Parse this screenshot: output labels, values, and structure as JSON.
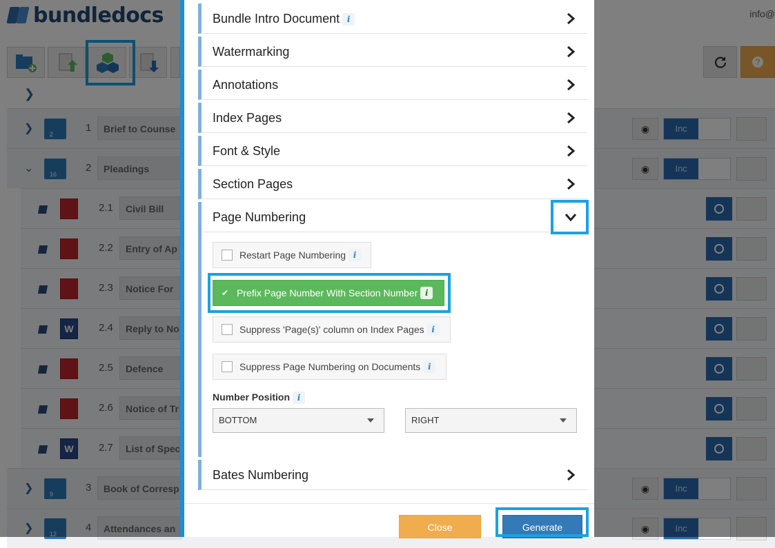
{
  "app": {
    "logo_text": "bundledocs",
    "user_label": "info@"
  },
  "colors": {
    "accent": "#1ba1e2",
    "primary": "#337ab7",
    "success": "#5cb85c",
    "warning": "#f0ad4e"
  },
  "toolbar": {
    "icons": [
      "folder-add-icon",
      "upload-icon",
      "generate-cubes-icon",
      "download-icon"
    ],
    "refresh_icon": "refresh-icon",
    "help_icon": "help-icon"
  },
  "tree": {
    "rows": [
      {
        "num": "1",
        "label": "Brief to Counse",
        "badge": "2",
        "type": "section"
      },
      {
        "num": "2",
        "label": "Pleadings",
        "badge": "16",
        "type": "section"
      },
      {
        "num": "2.1",
        "label": "Civil Bill",
        "type": "pdf"
      },
      {
        "num": "2.2",
        "label": "Entry of Ap",
        "type": "pdf"
      },
      {
        "num": "2.3",
        "label": "Notice For",
        "type": "pdf"
      },
      {
        "num": "2.4",
        "label": "Reply to No",
        "type": "word"
      },
      {
        "num": "2.5",
        "label": "Defence",
        "type": "pdf"
      },
      {
        "num": "2.6",
        "label": "Notice of Tr",
        "type": "pdf"
      },
      {
        "num": "2.7",
        "label": "List of Spec",
        "type": "word"
      },
      {
        "num": "3",
        "label": "Book of Corresp",
        "badge": "9",
        "type": "section"
      },
      {
        "num": "4",
        "label": "Attendances an",
        "badge": "12",
        "type": "section"
      }
    ],
    "inc_label": "Inc"
  },
  "modal": {
    "sections": [
      {
        "title": "Bundle Intro Document",
        "info": "i"
      },
      {
        "title": "Watermarking"
      },
      {
        "title": "Annotations"
      },
      {
        "title": "Index Pages"
      },
      {
        "title": "Font & Style"
      },
      {
        "title": "Section Pages"
      },
      {
        "title": "Page Numbering",
        "expanded": true
      },
      {
        "title": "Bates Numbering"
      }
    ],
    "page_numbering": {
      "options": [
        {
          "label": "Restart Page Numbering",
          "checked": false
        },
        {
          "label": "Prefix Page Number With Section Number",
          "checked": true
        },
        {
          "label": "Suppress 'Page(s)' column on Index Pages",
          "checked": false
        },
        {
          "label": "Suppress Page Numbering on Documents",
          "checked": false
        }
      ],
      "number_position_label": "Number Position",
      "vertical_select": "BOTTOM",
      "horizontal_select": "RIGHT"
    },
    "footer": {
      "close_label": "Close",
      "generate_label": "Generate"
    }
  }
}
